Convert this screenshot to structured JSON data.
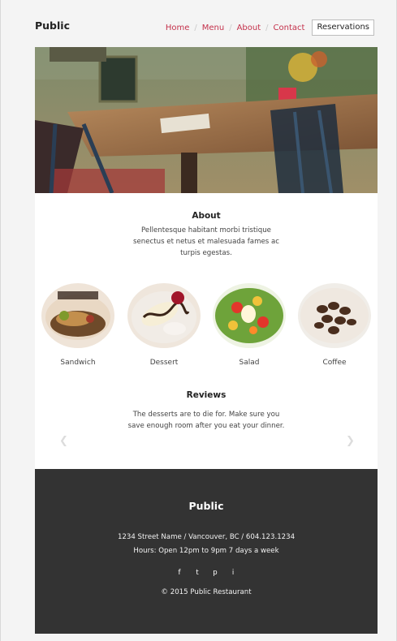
{
  "header": {
    "brand": "Public",
    "nav": [
      {
        "label": "Home"
      },
      {
        "label": "Menu"
      },
      {
        "label": "About"
      },
      {
        "label": "Contact"
      }
    ],
    "separator": "/",
    "reservations_label": "Reservations"
  },
  "about": {
    "title": "About",
    "text": "Pellentesque habitant morbi tristique senectus et netus et malesuada fames ac turpis egestas."
  },
  "menu_items": [
    {
      "label": "Sandwich"
    },
    {
      "label": "Dessert"
    },
    {
      "label": "Salad"
    },
    {
      "label": "Coffee"
    }
  ],
  "reviews": {
    "title": "Reviews",
    "text": "The desserts are to die for. Make sure you save enough room after you eat your dinner.",
    "prev_icon": "chevron-left-icon",
    "next_icon": "chevron-right-icon"
  },
  "footer": {
    "brand": "Public",
    "address": "1234 Street Name / Vancouver, BC / 604.123.1234",
    "hours": "Hours: Open 12pm to 9pm 7 days a week",
    "social": [
      {
        "icon": "facebook-icon",
        "glyph": "f"
      },
      {
        "icon": "twitter-icon",
        "glyph": "t"
      },
      {
        "icon": "pinterest-icon",
        "glyph": "p"
      },
      {
        "icon": "instagram-icon",
        "glyph": "i"
      }
    ],
    "copyright": "© 2015 Public Restaurant"
  },
  "colors": {
    "accent": "#c4314b",
    "footer_bg": "#333333",
    "page_bg": "#f4f4f4"
  }
}
